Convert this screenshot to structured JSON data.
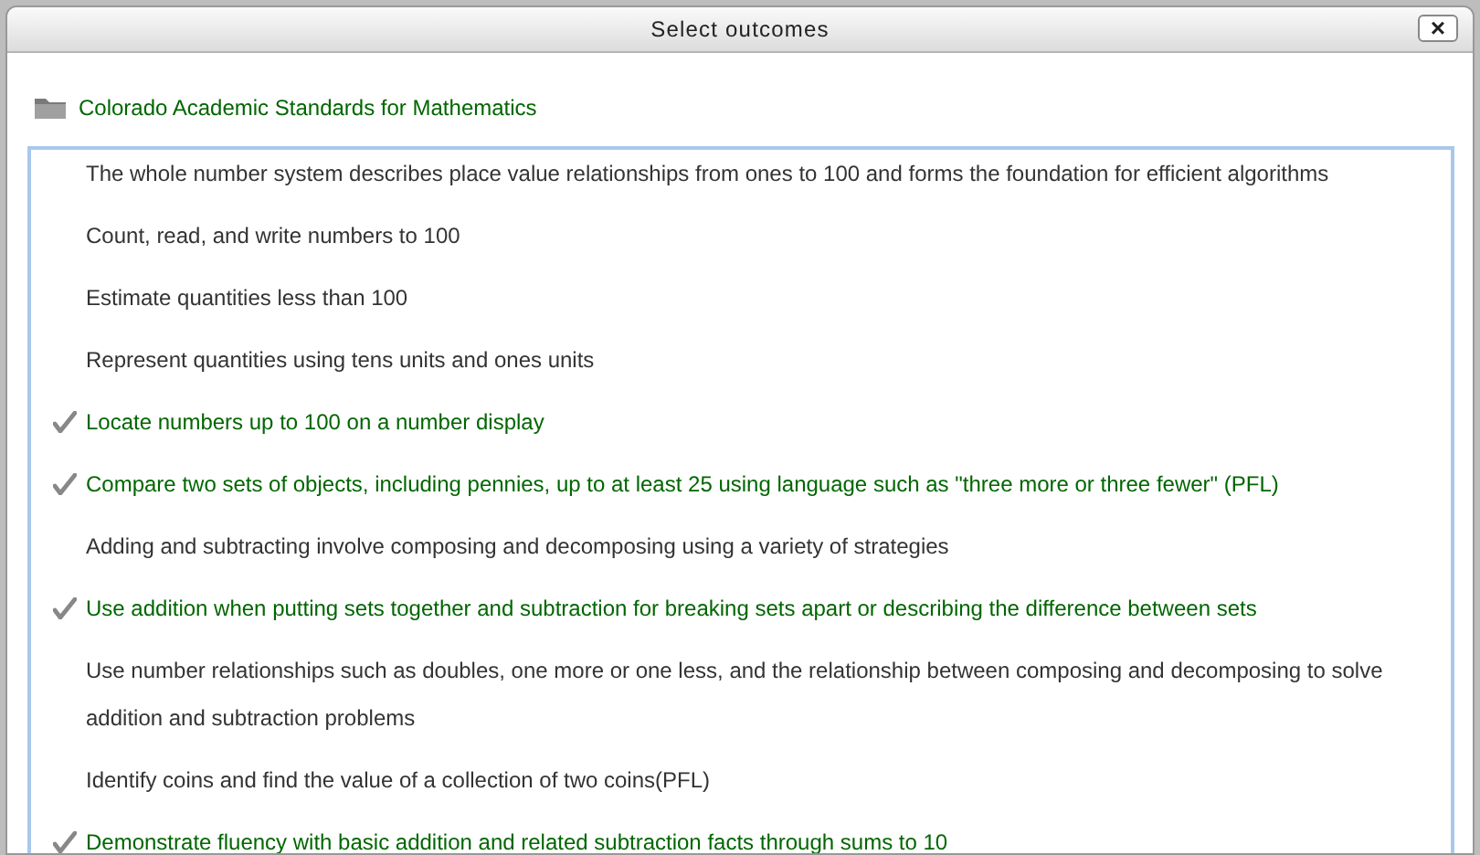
{
  "dialog": {
    "title": "Select outcomes",
    "close": "×"
  },
  "framework": {
    "label": "Colorado Academic Standards for Mathematics"
  },
  "outcomes": [
    {
      "text": "The whole number system describes place value relationships from ones to 100 and forms the foundation for efficient algorithms",
      "checked": false
    },
    {
      "text": "Count, read, and write numbers to 100",
      "checked": false
    },
    {
      "text": "Estimate quantities less than 100",
      "checked": false
    },
    {
      "text": "Represent quantities using tens units and ones units",
      "checked": false
    },
    {
      "text": "Locate numbers up to 100 on a number display",
      "checked": true
    },
    {
      "text": "Compare two sets of objects, including pennies, up to at least 25 using language such as \"three more or three fewer\" (PFL)",
      "checked": true
    },
    {
      "text": "Adding and subtracting involve composing and decomposing using a variety of strategies",
      "checked": false
    },
    {
      "text": "Use addition when putting sets together and subtraction for breaking sets apart or describing the difference between sets",
      "checked": true
    },
    {
      "text": "Use number relationships such as doubles, one more or one less, and the relationship between composing and decomposing to solve addition and subtraction problems",
      "checked": false
    },
    {
      "text": "Identify coins and find the value of a collection of two coins(PFL)",
      "checked": false
    },
    {
      "text": "Demonstrate fluency with basic addition and related subtraction facts through sums to 10",
      "checked": true
    }
  ]
}
